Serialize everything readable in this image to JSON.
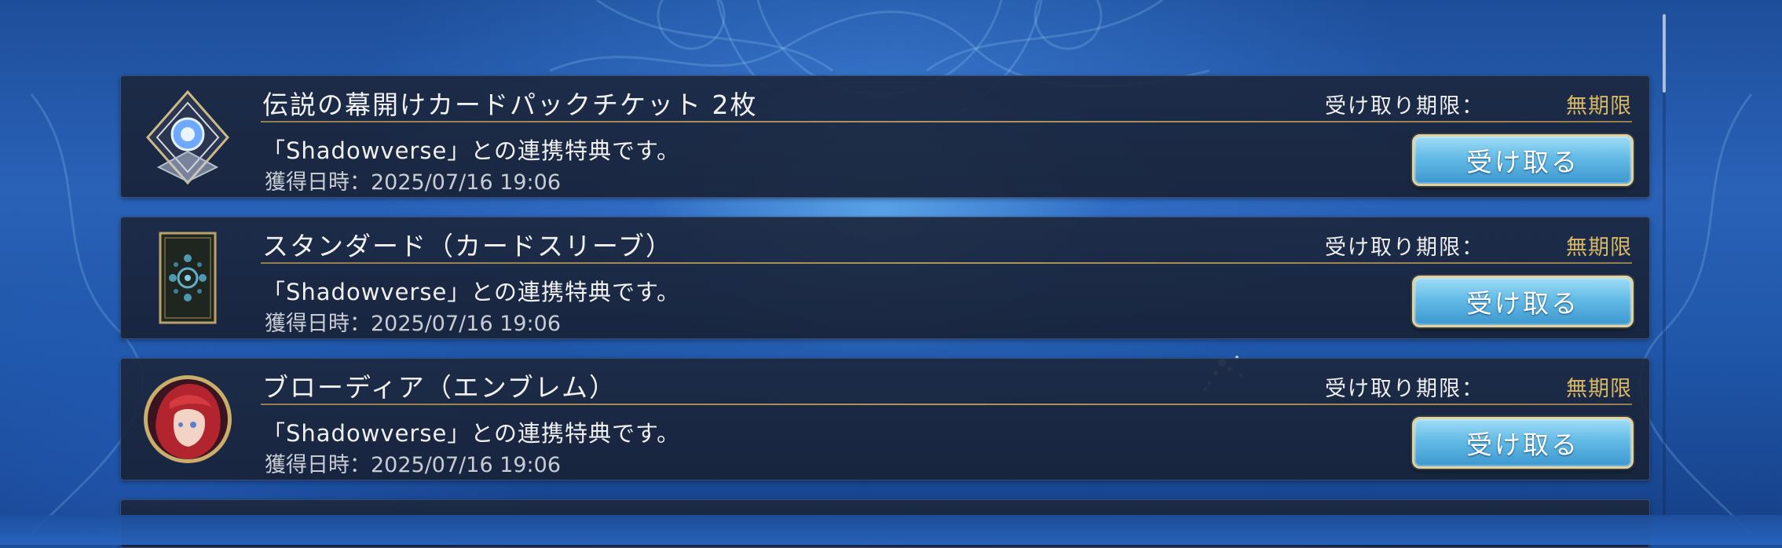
{
  "gifts": [
    {
      "title": "伝説の幕開けカードパックチケット 2枚",
      "deadline_label": "受け取り期限：",
      "deadline_value": "無期限",
      "description": "「Shadowverse」との連携特典です。",
      "acquired": "獲得日時：2025/07/16 19:06",
      "button_label": "受け取る",
      "icon": "card-pack-ticket-icon"
    },
    {
      "title": "スタンダード（カードスリーブ）",
      "deadline_label": "受け取り期限：",
      "deadline_value": "無期限",
      "description": "「Shadowverse」との連携特典です。",
      "acquired": "獲得日時：2025/07/16 19:06",
      "button_label": "受け取る",
      "icon": "card-sleeve-icon"
    },
    {
      "title": "ブローディア（エンブレム）",
      "deadline_label": "受け取り期限：",
      "deadline_value": "無期限",
      "description": "「Shadowverse」との連携特典です。",
      "acquired": "獲得日時：2025/07/16 19:06",
      "button_label": "受け取る",
      "icon": "emblem-portrait-icon"
    }
  ],
  "colors": {
    "gold_accent": "#d9b865",
    "button_blue": "#63bbe6",
    "panel": "#1c2840"
  }
}
